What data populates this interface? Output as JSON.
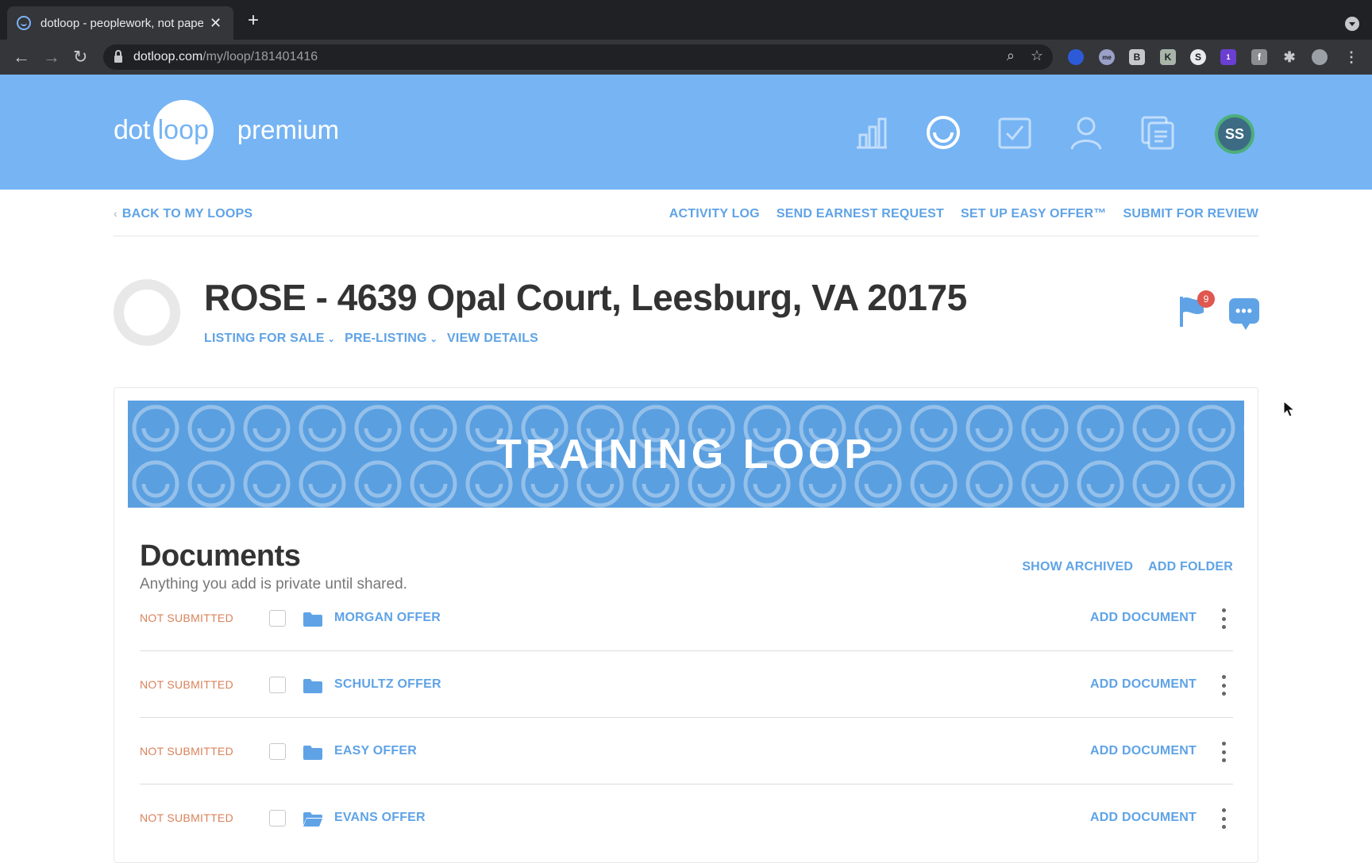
{
  "browser": {
    "tab_title": "dotloop - peoplework, not paperwork",
    "url_host": "dotloop.com",
    "url_path": "/my/loop/181401416",
    "extension_badge": "1"
  },
  "header": {
    "logo_dot": "dot",
    "logo_loop": "loop",
    "logo_premium": "premium",
    "avatar_initials": "SS"
  },
  "loop_nav": {
    "back_label": "BACK TO MY LOOPS",
    "actions": [
      "ACTIVITY LOG",
      "SEND EARNEST REQUEST",
      "SET UP EASY OFFER™",
      "SUBMIT FOR REVIEW"
    ]
  },
  "loop": {
    "title": "ROSE - 4639 Opal Court, Leesburg, VA 20175",
    "type": "LISTING FOR SALE",
    "status": "PRE-LISTING",
    "details_label": "VIEW DETAILS",
    "flag_count": "9",
    "chat_glyph": "•••"
  },
  "banner": {
    "text": "TRAINING LOOP"
  },
  "documents": {
    "title": "Documents",
    "subtitle": "Anything you add is private until shared.",
    "show_archived": "SHOW ARCHIVED",
    "add_folder": "ADD FOLDER",
    "rows": [
      {
        "status": "NOT SUBMITTED",
        "name": "MORGAN OFFER",
        "action": "ADD DOCUMENT"
      },
      {
        "status": "NOT SUBMITTED",
        "name": "SCHULTZ OFFER",
        "action": "ADD DOCUMENT"
      },
      {
        "status": "NOT SUBMITTED",
        "name": "EASY OFFER",
        "action": "ADD DOCUMENT"
      },
      {
        "status": "NOT SUBMITTED",
        "name": "EVANS OFFER",
        "action": "ADD DOCUMENT"
      }
    ]
  },
  "colors": {
    "header_blue": "#76b4f4",
    "link_blue": "#5fa3e6",
    "status_orange": "#d9825a",
    "badge_red": "#e0574f"
  }
}
